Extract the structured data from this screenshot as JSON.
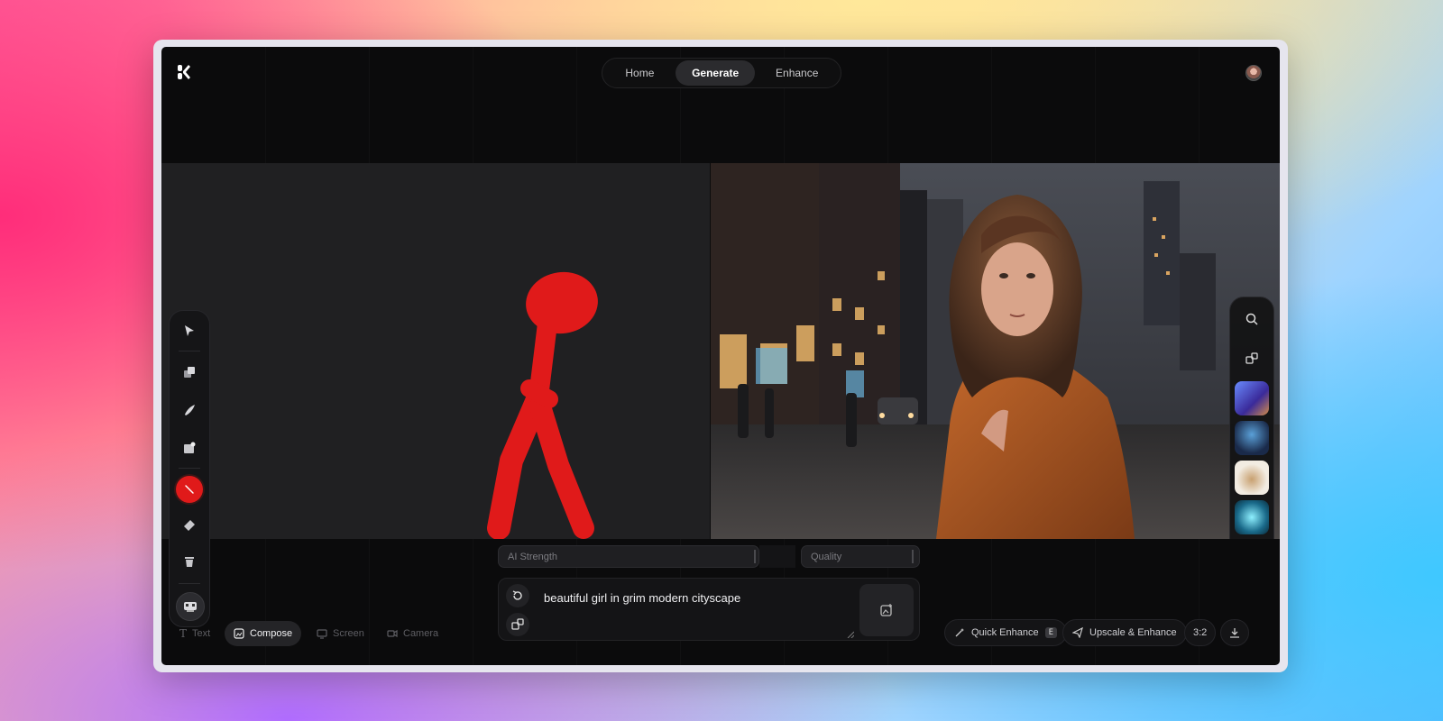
{
  "nav": {
    "tabs": [
      {
        "label": "Home"
      },
      {
        "label": "Generate"
      },
      {
        "label": "Enhance"
      }
    ],
    "active_tab": "Generate"
  },
  "sketch": {
    "stroke_color": "#e01a1a",
    "background_color": "#202022"
  },
  "left_toolbar": {
    "tools": [
      "select-icon",
      "layers-icon",
      "brush-icon",
      "image-add-icon",
      "color-picker",
      "eraser-icon",
      "trash-icon",
      "mascot-icon"
    ],
    "selected_color": "#e01a1a"
  },
  "right_gallery": {
    "buttons": [
      "search-icon",
      "shapes-icon"
    ],
    "thumbnails": [
      "style-thumbnail-1",
      "style-thumbnail-2",
      "style-thumbnail-3",
      "style-thumbnail-4",
      "style-thumbnail-5",
      "style-thumbnail-6"
    ]
  },
  "controls": {
    "ai_strength_label": "AI Strength",
    "quality_label": "Quality"
  },
  "prompt": {
    "text": "beautiful girl in grim modern cityscape"
  },
  "modes": {
    "text": "Text",
    "compose": "Compose",
    "screen": "Screen",
    "camera": "Camera",
    "active": "Compose"
  },
  "actions": {
    "quick_enhance": "Quick Enhance",
    "quick_enhance_shortcut": "E",
    "upscale_enhance": "Upscale & Enhance",
    "aspect_ratio": "3:2"
  }
}
